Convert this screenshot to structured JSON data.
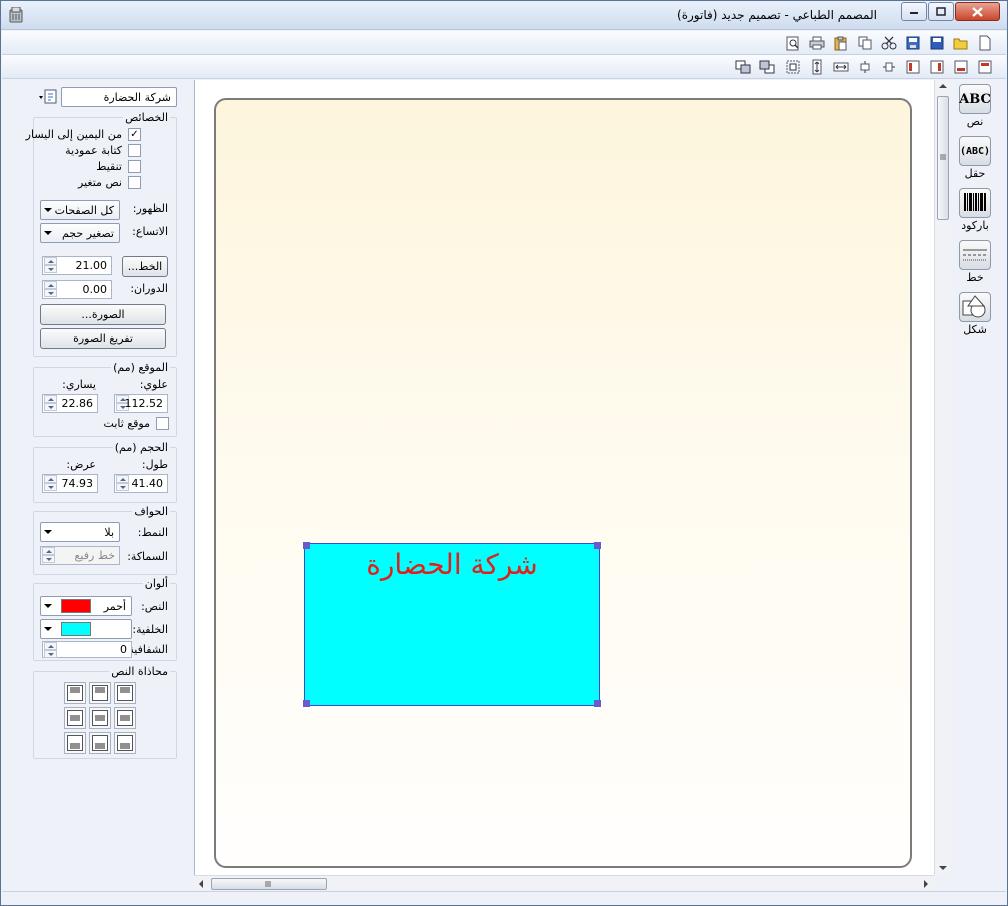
{
  "window": {
    "title": "المصمم الطباعي - تصميم جديد (فاتورة)"
  },
  "toolbar_main": {
    "icons": [
      "new-document-icon",
      "open-folder-icon",
      "save-icon",
      "save-as-icon",
      "cut-icon",
      "copy-icon",
      "paste-icon",
      "print-icon",
      "print-preview-icon"
    ]
  },
  "toolbar_layout": {
    "icons": [
      "align-top-icon",
      "align-bottom-icon",
      "align-right-icon",
      "align-left-icon",
      "center-vertical-icon",
      "center-horizontal-icon",
      "distribute-vertical-icon",
      "distribute-horizontal-icon",
      "bring-front-icon",
      "send-back-icon"
    ]
  },
  "panel": {
    "object_selector": "شركة الحضارة",
    "properties": {
      "title": "الخصائص",
      "rtl_label": "من اليمين إلى اليسار",
      "rtl_checked": true,
      "vertical_label": "كتابة عمودية",
      "vertical_checked": false,
      "dotted_label": "تنقيط",
      "dotted_checked": false,
      "variable_label": "نص متغير",
      "variable_checked": false,
      "visibility_label": "الظهور:",
      "visibility_value": "كل الصفحات",
      "fit_label": "الاتساع:",
      "fit_value": "تصغير حجم",
      "font_button": "الخط...",
      "font_size": "21.00",
      "rotation_label": "الدوران:",
      "rotation_value": "0.00",
      "image_button": "الصورة...",
      "clear_image_button": "تفريغ الصورة"
    },
    "position": {
      "title": "الموقع (مم)",
      "top_label": "علوي:",
      "left_label": "يساري:",
      "top_value": "112.52",
      "left_value": "22.86",
      "fixed_label": "موقع ثابت",
      "fixed_checked": false
    },
    "size": {
      "title": "الحجم (مم)",
      "height_label": "طول:",
      "width_label": "عرض:",
      "height_value": "41.40",
      "width_value": "74.93"
    },
    "borders": {
      "title": "الحواف",
      "style_label": "النمط:",
      "style_value": "بلا",
      "thickness_label": "السماكة:",
      "thickness_value": "خط رفيع"
    },
    "colors": {
      "title": "ألوان",
      "text_label": "النص:",
      "text_value": "أحمر",
      "text_color": "#ff0000",
      "background_label": "الخلفية:",
      "background_color": "#00ffff",
      "transparency_label": "الشفافية",
      "transparency_value": "0"
    },
    "text_align": {
      "title": "محاذاة النص"
    }
  },
  "canvas": {
    "element_text": "شركة الحضارة",
    "element_bg": "#00ffff",
    "element_text_color": "#e0201a",
    "handle_color": "#6a5acd"
  },
  "tools": {
    "text_icon_glyph": "ABC",
    "text_label": "نص",
    "field_icon_glyph": "(ABC)",
    "field_label": "حقل",
    "barcode_label": "باركود",
    "line_label": "خط",
    "shape_label": "شكل"
  }
}
